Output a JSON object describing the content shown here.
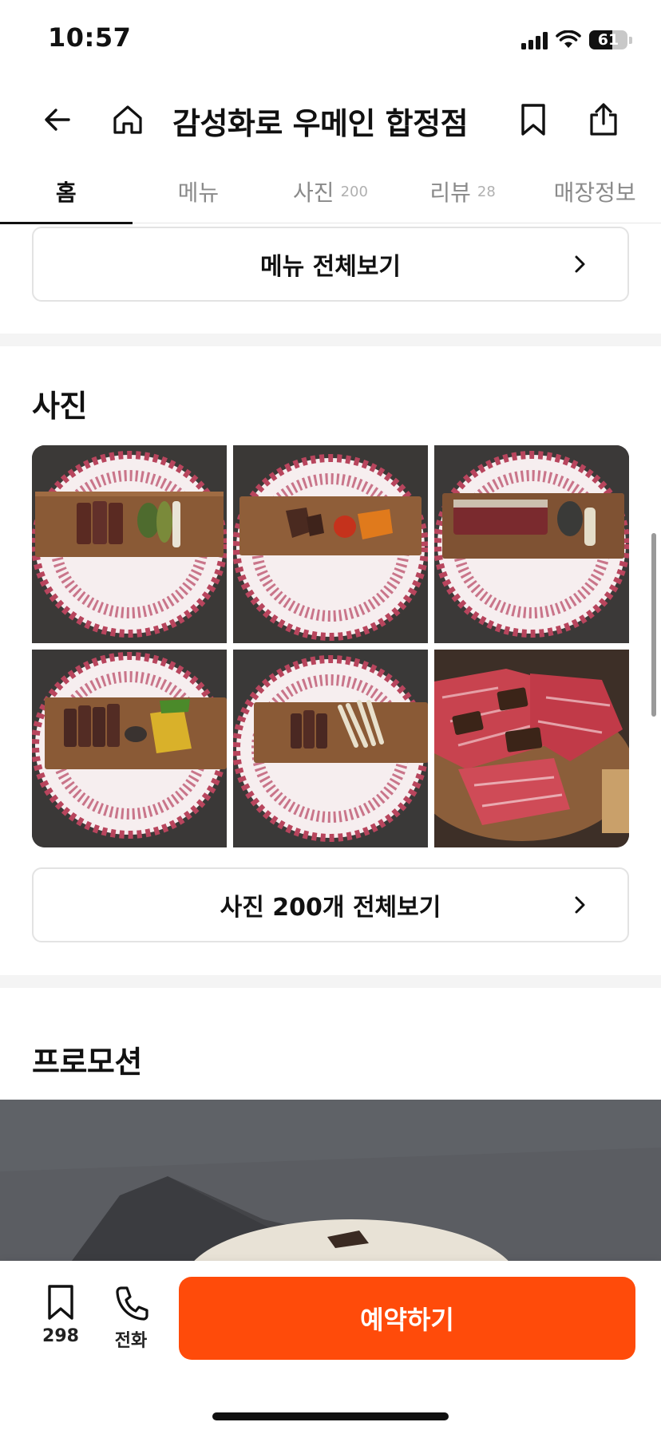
{
  "status_bar": {
    "time": "10:57",
    "battery": "61",
    "battery_level": 0.61
  },
  "header": {
    "title": "감성화로 우메인 합정점"
  },
  "tabs": [
    {
      "label": "홈",
      "count": ""
    },
    {
      "label": "메뉴",
      "count": ""
    },
    {
      "label": "사진",
      "count": "200"
    },
    {
      "label": "리뷰",
      "count": "28"
    },
    {
      "label": "매장정보",
      "count": ""
    }
  ],
  "menu_section": {
    "view_all_label": "메뉴 전체보기"
  },
  "photos_section": {
    "title": "사진",
    "view_all_label": "사진 200개 전체보기"
  },
  "promotion_section": {
    "title": "프로모션"
  },
  "bottom_bar": {
    "bookmark_count": "298",
    "call_label": "전화",
    "reserve_label": "예약하기"
  },
  "colors": {
    "accent": "#ff4b0a",
    "divider": "#f4f4f4"
  }
}
